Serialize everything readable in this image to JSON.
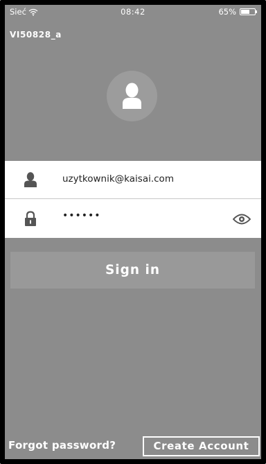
{
  "status_bar": {
    "carrier": "Sieć",
    "time": "08:42",
    "battery_percent": "65%",
    "battery_level": 0.65,
    "wifi_icon": "wifi-icon",
    "battery_icon": "battery-icon"
  },
  "device": {
    "name": "VI50828_a"
  },
  "avatar": {
    "icon": "user-icon"
  },
  "login": {
    "username_icon": "user-icon",
    "username": "uzytkownik@kaisai.com",
    "password_icon": "lock-icon",
    "password": "••••••",
    "show_password_icon": "eye-icon",
    "signin_label": "Sign in"
  },
  "footer": {
    "forgot_label": "Forgot password?",
    "create_label": "Create Account"
  },
  "colors": {
    "background": "#8c8c8c",
    "button": "#999999",
    "form_background": "#ffffff",
    "text": "#ffffff",
    "icon": "#555555"
  }
}
